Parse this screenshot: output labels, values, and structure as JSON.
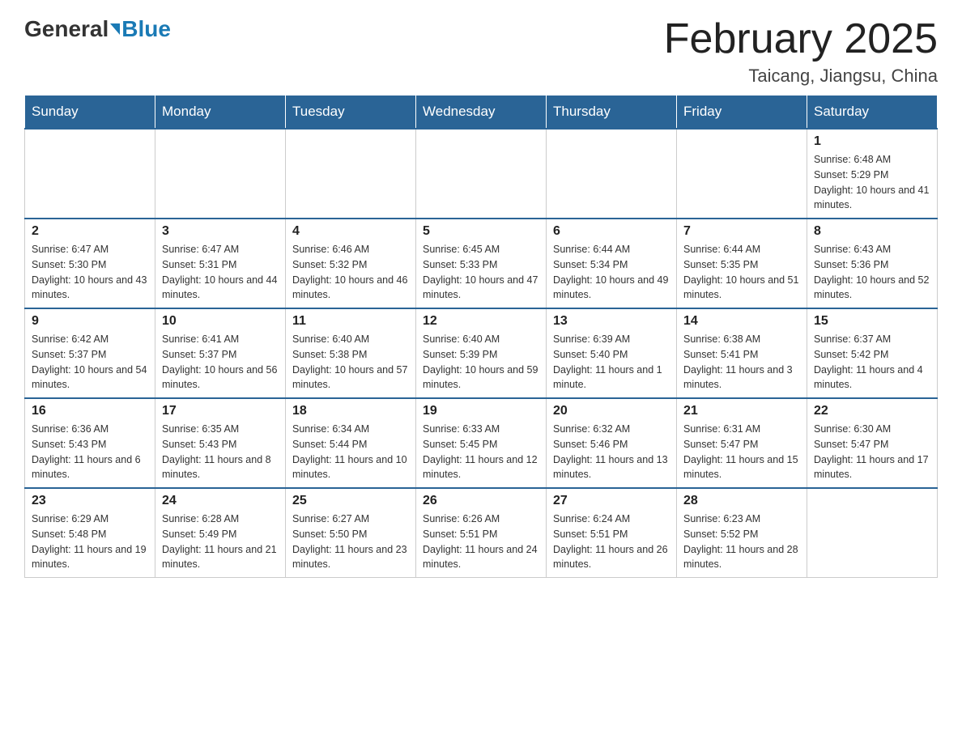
{
  "header": {
    "logo_general": "General",
    "logo_blue": "Blue",
    "month_title": "February 2025",
    "location": "Taicang, Jiangsu, China"
  },
  "days_of_week": [
    "Sunday",
    "Monday",
    "Tuesday",
    "Wednesday",
    "Thursday",
    "Friday",
    "Saturday"
  ],
  "weeks": [
    [
      {
        "day": "",
        "sunrise": "",
        "sunset": "",
        "daylight": "",
        "empty": true
      },
      {
        "day": "",
        "sunrise": "",
        "sunset": "",
        "daylight": "",
        "empty": true
      },
      {
        "day": "",
        "sunrise": "",
        "sunset": "",
        "daylight": "",
        "empty": true
      },
      {
        "day": "",
        "sunrise": "",
        "sunset": "",
        "daylight": "",
        "empty": true
      },
      {
        "day": "",
        "sunrise": "",
        "sunset": "",
        "daylight": "",
        "empty": true
      },
      {
        "day": "",
        "sunrise": "",
        "sunset": "",
        "daylight": "",
        "empty": true
      },
      {
        "day": "1",
        "sunrise": "Sunrise: 6:48 AM",
        "sunset": "Sunset: 5:29 PM",
        "daylight": "Daylight: 10 hours and 41 minutes.",
        "empty": false
      }
    ],
    [
      {
        "day": "2",
        "sunrise": "Sunrise: 6:47 AM",
        "sunset": "Sunset: 5:30 PM",
        "daylight": "Daylight: 10 hours and 43 minutes.",
        "empty": false
      },
      {
        "day": "3",
        "sunrise": "Sunrise: 6:47 AM",
        "sunset": "Sunset: 5:31 PM",
        "daylight": "Daylight: 10 hours and 44 minutes.",
        "empty": false
      },
      {
        "day": "4",
        "sunrise": "Sunrise: 6:46 AM",
        "sunset": "Sunset: 5:32 PM",
        "daylight": "Daylight: 10 hours and 46 minutes.",
        "empty": false
      },
      {
        "day": "5",
        "sunrise": "Sunrise: 6:45 AM",
        "sunset": "Sunset: 5:33 PM",
        "daylight": "Daylight: 10 hours and 47 minutes.",
        "empty": false
      },
      {
        "day": "6",
        "sunrise": "Sunrise: 6:44 AM",
        "sunset": "Sunset: 5:34 PM",
        "daylight": "Daylight: 10 hours and 49 minutes.",
        "empty": false
      },
      {
        "day": "7",
        "sunrise": "Sunrise: 6:44 AM",
        "sunset": "Sunset: 5:35 PM",
        "daylight": "Daylight: 10 hours and 51 minutes.",
        "empty": false
      },
      {
        "day": "8",
        "sunrise": "Sunrise: 6:43 AM",
        "sunset": "Sunset: 5:36 PM",
        "daylight": "Daylight: 10 hours and 52 minutes.",
        "empty": false
      }
    ],
    [
      {
        "day": "9",
        "sunrise": "Sunrise: 6:42 AM",
        "sunset": "Sunset: 5:37 PM",
        "daylight": "Daylight: 10 hours and 54 minutes.",
        "empty": false
      },
      {
        "day": "10",
        "sunrise": "Sunrise: 6:41 AM",
        "sunset": "Sunset: 5:37 PM",
        "daylight": "Daylight: 10 hours and 56 minutes.",
        "empty": false
      },
      {
        "day": "11",
        "sunrise": "Sunrise: 6:40 AM",
        "sunset": "Sunset: 5:38 PM",
        "daylight": "Daylight: 10 hours and 57 minutes.",
        "empty": false
      },
      {
        "day": "12",
        "sunrise": "Sunrise: 6:40 AM",
        "sunset": "Sunset: 5:39 PM",
        "daylight": "Daylight: 10 hours and 59 minutes.",
        "empty": false
      },
      {
        "day": "13",
        "sunrise": "Sunrise: 6:39 AM",
        "sunset": "Sunset: 5:40 PM",
        "daylight": "Daylight: 11 hours and 1 minute.",
        "empty": false
      },
      {
        "day": "14",
        "sunrise": "Sunrise: 6:38 AM",
        "sunset": "Sunset: 5:41 PM",
        "daylight": "Daylight: 11 hours and 3 minutes.",
        "empty": false
      },
      {
        "day": "15",
        "sunrise": "Sunrise: 6:37 AM",
        "sunset": "Sunset: 5:42 PM",
        "daylight": "Daylight: 11 hours and 4 minutes.",
        "empty": false
      }
    ],
    [
      {
        "day": "16",
        "sunrise": "Sunrise: 6:36 AM",
        "sunset": "Sunset: 5:43 PM",
        "daylight": "Daylight: 11 hours and 6 minutes.",
        "empty": false
      },
      {
        "day": "17",
        "sunrise": "Sunrise: 6:35 AM",
        "sunset": "Sunset: 5:43 PM",
        "daylight": "Daylight: 11 hours and 8 minutes.",
        "empty": false
      },
      {
        "day": "18",
        "sunrise": "Sunrise: 6:34 AM",
        "sunset": "Sunset: 5:44 PM",
        "daylight": "Daylight: 11 hours and 10 minutes.",
        "empty": false
      },
      {
        "day": "19",
        "sunrise": "Sunrise: 6:33 AM",
        "sunset": "Sunset: 5:45 PM",
        "daylight": "Daylight: 11 hours and 12 minutes.",
        "empty": false
      },
      {
        "day": "20",
        "sunrise": "Sunrise: 6:32 AM",
        "sunset": "Sunset: 5:46 PM",
        "daylight": "Daylight: 11 hours and 13 minutes.",
        "empty": false
      },
      {
        "day": "21",
        "sunrise": "Sunrise: 6:31 AM",
        "sunset": "Sunset: 5:47 PM",
        "daylight": "Daylight: 11 hours and 15 minutes.",
        "empty": false
      },
      {
        "day": "22",
        "sunrise": "Sunrise: 6:30 AM",
        "sunset": "Sunset: 5:47 PM",
        "daylight": "Daylight: 11 hours and 17 minutes.",
        "empty": false
      }
    ],
    [
      {
        "day": "23",
        "sunrise": "Sunrise: 6:29 AM",
        "sunset": "Sunset: 5:48 PM",
        "daylight": "Daylight: 11 hours and 19 minutes.",
        "empty": false
      },
      {
        "day": "24",
        "sunrise": "Sunrise: 6:28 AM",
        "sunset": "Sunset: 5:49 PM",
        "daylight": "Daylight: 11 hours and 21 minutes.",
        "empty": false
      },
      {
        "day": "25",
        "sunrise": "Sunrise: 6:27 AM",
        "sunset": "Sunset: 5:50 PM",
        "daylight": "Daylight: 11 hours and 23 minutes.",
        "empty": false
      },
      {
        "day": "26",
        "sunrise": "Sunrise: 6:26 AM",
        "sunset": "Sunset: 5:51 PM",
        "daylight": "Daylight: 11 hours and 24 minutes.",
        "empty": false
      },
      {
        "day": "27",
        "sunrise": "Sunrise: 6:24 AM",
        "sunset": "Sunset: 5:51 PM",
        "daylight": "Daylight: 11 hours and 26 minutes.",
        "empty": false
      },
      {
        "day": "28",
        "sunrise": "Sunrise: 6:23 AM",
        "sunset": "Sunset: 5:52 PM",
        "daylight": "Daylight: 11 hours and 28 minutes.",
        "empty": false
      },
      {
        "day": "",
        "sunrise": "",
        "sunset": "",
        "daylight": "",
        "empty": true
      }
    ]
  ]
}
